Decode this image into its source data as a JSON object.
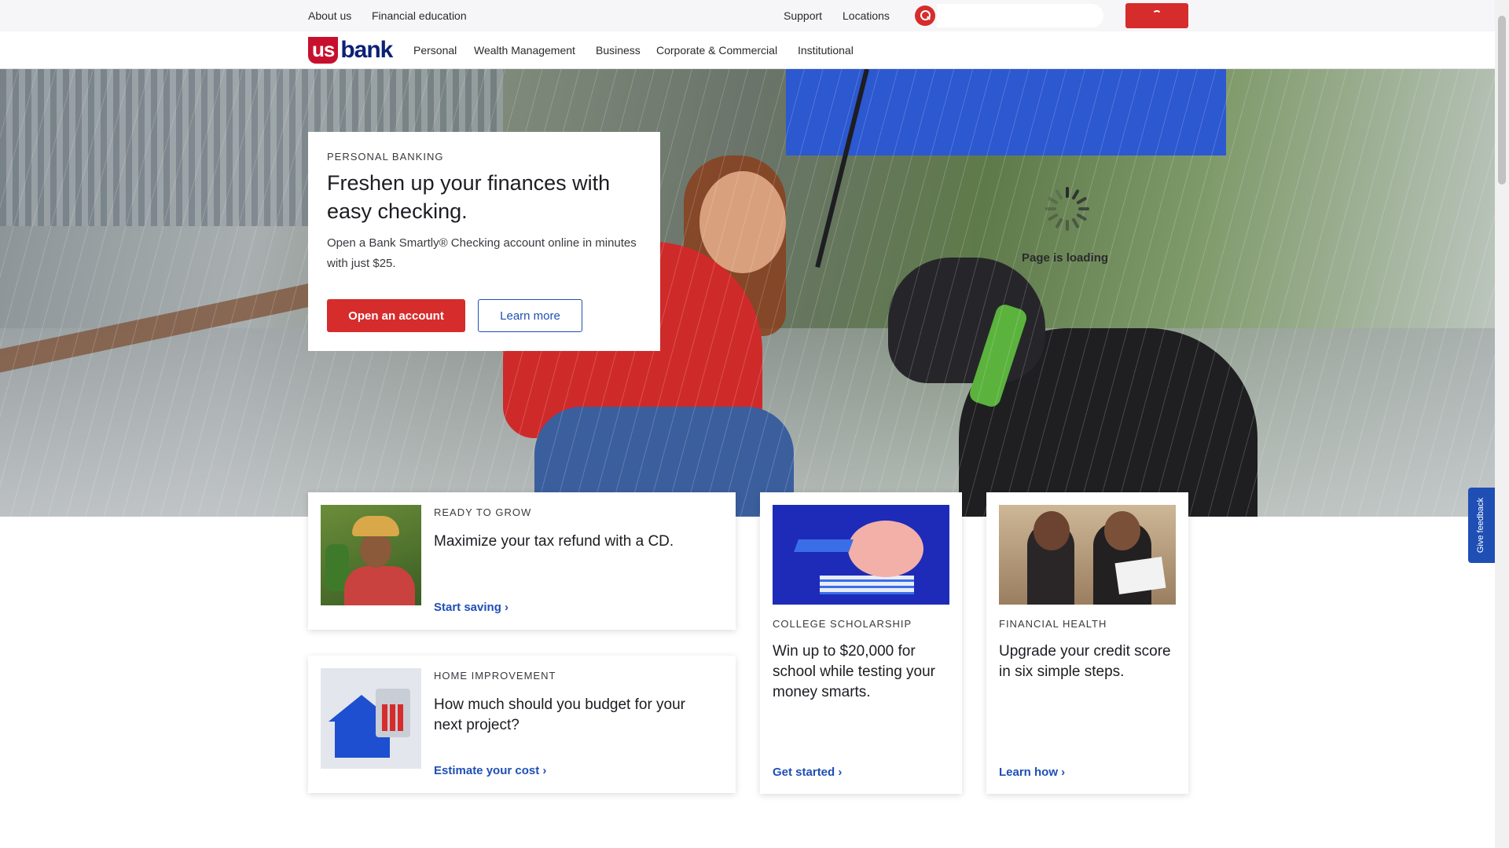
{
  "utility_nav": {
    "about": "About us",
    "financial_education": "Financial education",
    "support": "Support",
    "locations": "Locations",
    "search_placeholder": ""
  },
  "brand": {
    "logo_us": "us",
    "logo_bank": "bank",
    "primary_color": "#d62c2c",
    "navy": "#0c2074",
    "link_blue": "#1f4fb5"
  },
  "main_nav": [
    "Personal",
    "Wealth Management",
    "Business",
    "Corporate & Commercial",
    "Institutional"
  ],
  "hero": {
    "eyebrow": "PERSONAL BANKING",
    "title": "Freshen up your finances with easy checking.",
    "body": "Open a Bank Smartly® Checking account online in minutes with just $25.",
    "primary_cta": "Open an account",
    "secondary_cta": "Learn more",
    "loading_text": "Page is loading"
  },
  "cards": [
    {
      "eyebrow": "READY TO GROW",
      "title": "Maximize your tax refund with a CD.",
      "link": "Start saving",
      "icon": "farmer-photo"
    },
    {
      "eyebrow": "HOME IMPROVEMENT",
      "title": "How much should you budget for your next project?",
      "link": "Estimate your cost",
      "icon": "house-calculator-illustration"
    },
    {
      "eyebrow": "COLLEGE SCHOLARSHIP",
      "title": "Win up to $20,000 for school while testing your money smarts.",
      "link": "Get started",
      "icon": "piggy-bank-graduation-illustration"
    },
    {
      "eyebrow": "FINANCIAL HEALTH",
      "title": "Upgrade your credit score in six simple steps.",
      "link": "Learn how",
      "icon": "couple-reviewing-papers-photo"
    }
  ],
  "feedback": "Give feedback"
}
